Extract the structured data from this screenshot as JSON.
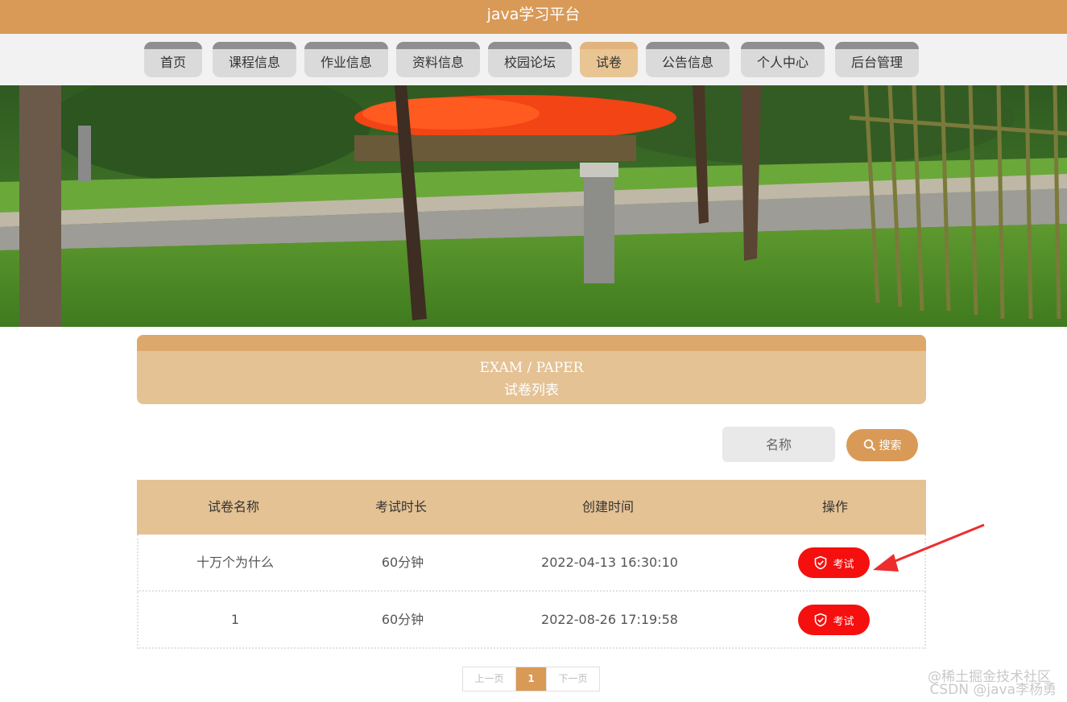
{
  "site": {
    "title": "java学习平台"
  },
  "nav": {
    "items": [
      {
        "label": "首页",
        "active": false
      },
      {
        "label": "课程信息",
        "active": false
      },
      {
        "label": "作业信息",
        "active": false
      },
      {
        "label": "资料信息",
        "active": false
      },
      {
        "label": "校园论坛",
        "active": false
      },
      {
        "label": "试卷",
        "active": true
      },
      {
        "label": "公告信息",
        "active": false
      },
      {
        "label": "个人中心",
        "active": false
      },
      {
        "label": "后台管理",
        "active": false
      }
    ]
  },
  "section": {
    "title_en": "EXAM / PAPER",
    "title_cn": "试卷列表"
  },
  "search": {
    "placeholder": "名称",
    "button_label": "搜索"
  },
  "table": {
    "columns": [
      "试卷名称",
      "考试时长",
      "创建时间",
      "操作"
    ],
    "rows": [
      {
        "name": "十万个为什么",
        "duration": "60分钟",
        "created": "2022-04-13 16:30:10",
        "action": "考试"
      },
      {
        "name": "1",
        "duration": "60分钟",
        "created": "2022-08-26 17:19:58",
        "action": "考试"
      }
    ]
  },
  "pagination": {
    "prev": "上一页",
    "current": "1",
    "next": "下一页"
  },
  "watermark": {
    "line1": "@稀土掘金技术社区",
    "line2": "CSDN @java李杨勇"
  },
  "colors": {
    "brand": "#d99a57",
    "header_band": "#e4c294",
    "danger": "#f50f0f",
    "nav_tab": "#dadada"
  }
}
